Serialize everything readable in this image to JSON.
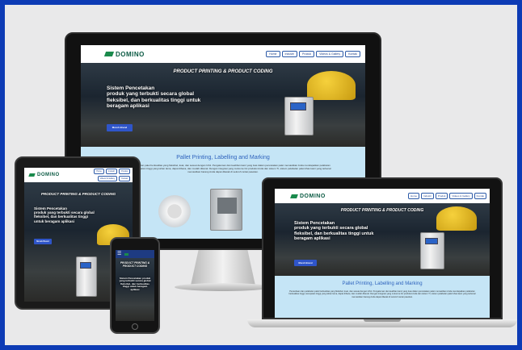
{
  "site": {
    "logo_text": "DOMINO",
    "nav": [
      "Home",
      "Industri",
      "Produk",
      "Videos & Gallery",
      "Kontak"
    ],
    "hero_title": "PRODUCT PRINTING & PRODUCT CODING",
    "hero_heading_line1": "Sistem Pencetakan",
    "hero_heading_rest": "produk yang terbukti secara global fleksibel, dan berkualitas tinggi untuk beragam aplikasi",
    "cta_label": "Moreh Brend",
    "section_title": "Pallet Printing, Labelling and Marking",
    "section_text": "Penandaan dan pelabelan palet berkualitas yang fleksibel, kuat, dan sesuai dengan GS1. Pengaleman dan keahlian kami yang luas dalam pencetakan palet memastikan Anda mendapatkan pelabelan berkualitas tinggi, kecepatan tinggi yang tahan lama, dapat dibaca, dan mudah dikenal. Dengan integrasi yang mulus ke lini produksi Anda dan sistem TI, sistem pelabelan palet khas kami yang terkenal memastikan barang Anda dapat dilacak di seluruh rantai pasokan."
  },
  "tablet_nav": [
    "Home",
    "Industri",
    "Produk",
    "Videos & Gallery",
    "Kontak"
  ],
  "phone_hero_title": "PRODUCT PRINTING & PRODUCT CODING",
  "phone_hero_text": "Sistem Pencetakan produk yang terbukti secara global fleksibel, dan berkualitas tinggi untuk beragam aplikasi",
  "colors": {
    "frame_border": "#0d3bb5",
    "brand_green": "#1a8a4c",
    "cta_blue": "#2f55c9",
    "section_bg": "#c5e5f6"
  }
}
